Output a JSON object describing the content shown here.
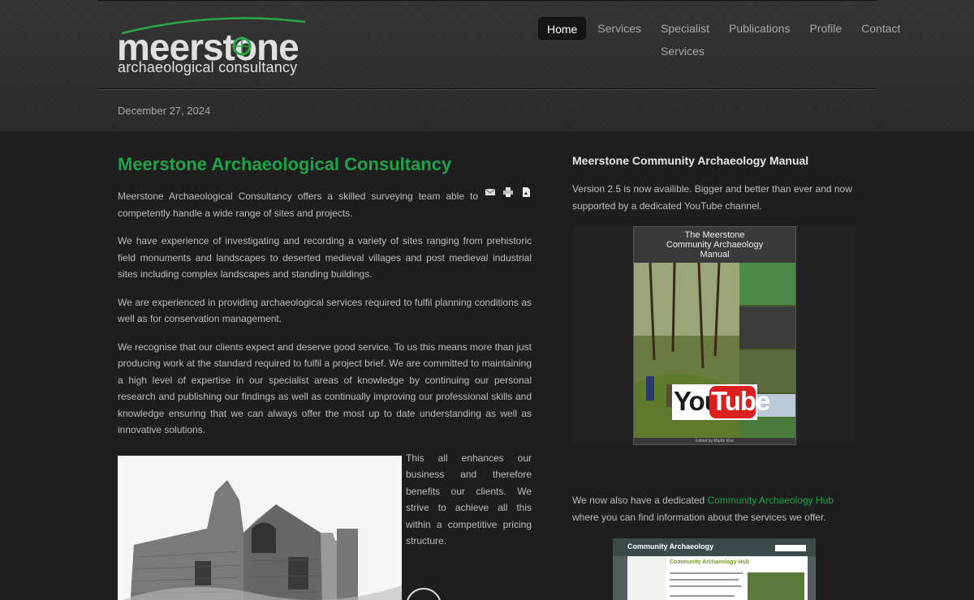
{
  "header": {
    "logo": {
      "word": "meerstone",
      "subtitle": "archaeological consultancy"
    },
    "nav": [
      {
        "label": "Home",
        "active": true
      },
      {
        "label": "Services",
        "active": false
      },
      {
        "label": "Specialist Services",
        "active": false
      },
      {
        "label": "Publications",
        "active": false
      },
      {
        "label": "Profile",
        "active": false
      },
      {
        "label": "Contact",
        "active": false
      }
    ],
    "date": "December 27, 2024"
  },
  "main": {
    "title": "Meerstone Archaeological Consultancy",
    "paragraphs": [
      "Meerstone Archaeological Consultancy offers a skilled surveying team able to competently handle a wide range of sites and projects.",
      "We have experience of investigating and recording a variety of sites ranging from prehistoric field monuments and landscapes to deserted medieval villages and post medieval industrial sites including complex landscapes and standing buildings.",
      "We are experienced in providing archaeological services required to fulfil planning conditions as well as for conservation management.",
      "We recognise that our clients expect and deserve good service. To us this means more than just producing work at the standard required to fulfil a project brief. We are committed to maintaining a high level of expertise in our specialist areas of knowledge by continuing our personal research and publishing our findings as well as continually improving our professional skills and knowledge ensuring that we can always offer the most up to date understanding as well as innovative solutions."
    ],
    "side_text": "This all enhances our business and therefore benefits our clients. We strive to achieve all this within a competitive pricing structure.",
    "tool_icons": [
      "email-icon",
      "print-icon",
      "pdf-icon"
    ]
  },
  "sidebar": {
    "title": "Meerstone Community Archaeology Manual",
    "intro": "Version 2.5 is now availible. Bigger and better than ever and now supported by a dedicated YouTube channel.",
    "cover": {
      "title": "The Meerstone\nCommunity Archaeology\nManual",
      "editor": "Edited by Martin Roe"
    },
    "youtube": {
      "you": "You",
      "tube": "Tube"
    },
    "hub": {
      "before": "We now also have a dedicated ",
      "link": "Community Archaeology Hub",
      "after": " where you can find information about the services we offer."
    },
    "hub_screenshot": {
      "header": "Community Archaeology",
      "heading": "Community Archaeology Hub"
    }
  },
  "colors": {
    "accent_green": "#1fa34a",
    "background": "#1e1e1e",
    "header_background": "#2e2e2e",
    "youtube_red": "#d9201f"
  }
}
